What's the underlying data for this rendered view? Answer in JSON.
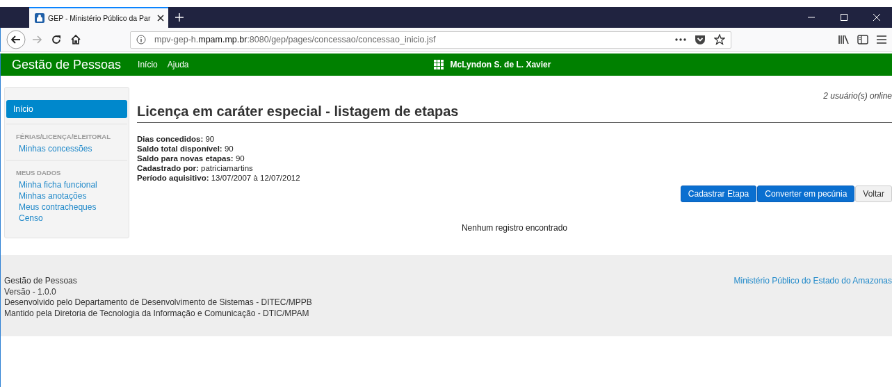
{
  "browser": {
    "tab_title": "GEP - Ministério Público da Par",
    "url_host_prefix": "mpv-gep-h.",
    "url_host_domain": "mpam.mp.br",
    "url_rest": ":8080/gep/pages/concessao/concessao_inicio.jsf"
  },
  "header": {
    "brand": "Gestão de Pessoas",
    "nav": [
      "Início",
      "Ajuda"
    ],
    "user": "McLyndon S. de L. Xavier"
  },
  "sidebar": {
    "home": {
      "label": "Início",
      "selected": true
    },
    "sections": [
      {
        "title": "FÉRIAS/LICENÇA/ELEITORAL",
        "items": [
          {
            "label": "Minhas concessões",
            "selected": false
          }
        ]
      },
      {
        "title": "MEUS DADOS",
        "items": [
          {
            "label": "Minha ficha funcional",
            "selected": false
          },
          {
            "label": "Minhas anotações",
            "selected": false
          },
          {
            "label": "Meus contracheques",
            "selected": false
          },
          {
            "label": "Censo",
            "selected": false
          }
        ]
      }
    ]
  },
  "online_users": "2 usuário(s) online",
  "page_title": "Licença em caráter especial - listagem de etapas",
  "details": [
    {
      "label": "Dias concedidos:",
      "value": "90"
    },
    {
      "label": "Saldo total disponível:",
      "value": "90"
    },
    {
      "label": "Saldo para novas etapas:",
      "value": "90"
    },
    {
      "label": "Cadastrado por:",
      "value": "patriciamartins"
    },
    {
      "label": "Período aquisitivo:",
      "value": "13/07/2007 à 12/07/2012"
    }
  ],
  "buttons": [
    {
      "label": "Cadastrar Etapa",
      "kind": "primary"
    },
    {
      "label": "Converter em pecúnia",
      "kind": "primary"
    },
    {
      "label": "Voltar",
      "kind": "default"
    }
  ],
  "empty_message": "Nenhum registro encontrado",
  "footer": {
    "lines": [
      "Gestão de Pessoas",
      "Versão - 1.0.0",
      "Desenvolvido pelo Departamento de Desenvolvimento de Sistemas - DITEC/MPPB",
      "Mantido pela Diretoria de Tecnologia da Informação e Comunicação - DTIC/MPAM"
    ],
    "link": "Ministério Público do Estado do Amazonas"
  }
}
